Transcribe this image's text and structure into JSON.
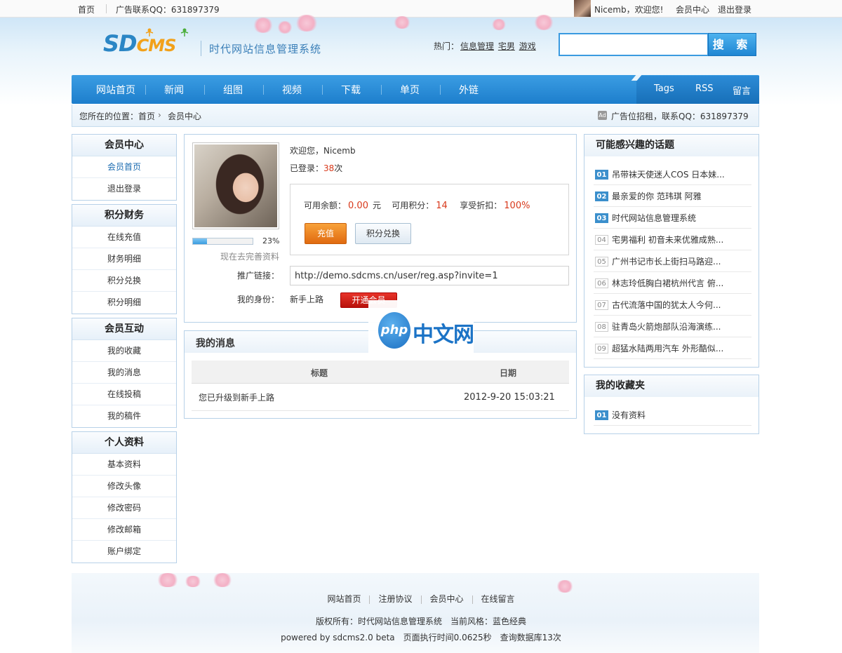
{
  "topbar": {
    "home": "首页",
    "ad_contact": "广告联系QQ：631897379",
    "welcome": "Nicemb，欢迎您!",
    "member_center": "会员中心",
    "logout": "退出登录"
  },
  "header": {
    "logo_sd": "SD",
    "logo_cms": "CMS",
    "slogan": "时代网站信息管理系统",
    "hot_label": "热门：",
    "hot_links": [
      "信息管理",
      "宅男",
      "游戏"
    ],
    "search_placeholder": "",
    "search_button": "搜 索"
  },
  "nav": {
    "items": [
      "网站首页",
      "新闻",
      "组图",
      "视频",
      "下载",
      "单页",
      "外链"
    ],
    "right": [
      "Tags",
      "RSS",
      "留言"
    ]
  },
  "breadcrumb": {
    "prefix": "您所在的位置：",
    "home": "首页",
    "current": "会员中心",
    "ad_icon": "Ad",
    "ad_text": "广告位招租，联系QQ：631897379"
  },
  "sidebar": [
    {
      "title": "会员中心",
      "items": [
        "会员首页",
        "退出登录"
      ]
    },
    {
      "title": "积分财务",
      "items": [
        "在线充值",
        "财务明细",
        "积分兑换",
        "积分明细"
      ]
    },
    {
      "title": "会员互动",
      "items": [
        "我的收藏",
        "我的消息",
        "在线投稿",
        "我的稿件"
      ]
    },
    {
      "title": "个人资料",
      "items": [
        "基本资料",
        "修改头像",
        "修改密码",
        "修改邮箱",
        "账户绑定"
      ]
    }
  ],
  "profile": {
    "completion": 0.23,
    "completion_text": "23%",
    "complete_link": "现在去完善资料",
    "welcome_prefix": "欢迎您，",
    "username": "Nicemb",
    "logins_prefix": "已登录：",
    "logins_count": "38",
    "logins_suffix": "次",
    "balance_label": "可用余额：",
    "balance": "0.00",
    "balance_unit": "元",
    "points_label": "可用积分：",
    "points": "14",
    "discount_label": "享受折扣：",
    "discount": "100%",
    "recharge_button": "充值",
    "exchange_button": "积分兑换",
    "promo_label": "推广链接：",
    "promo_url": "http://demo.sdcms.cn/user/reg.asp?invite=1",
    "identity_label": "我的身份：",
    "identity": "新手上路",
    "vip_button": "开通会员"
  },
  "messages": {
    "title": "我的消息",
    "columns": [
      "标题",
      "日期"
    ],
    "rows": [
      {
        "title": "您已升级到新手上路",
        "date": "2012-9-20 15:03:21"
      }
    ]
  },
  "watermark": {
    "logo": "php",
    "text": "中文网"
  },
  "topics": {
    "title": "可能感兴趣的话题",
    "items": [
      {
        "num": "01",
        "text": "吊带袜天使迷人COS 日本妹..."
      },
      {
        "num": "02",
        "text": "最亲爱的你 范玮琪 阿雅"
      },
      {
        "num": "03",
        "text": "时代网站信息管理系统"
      },
      {
        "num": "04",
        "text": "宅男福利 初音未来优雅成熟..."
      },
      {
        "num": "05",
        "text": "广州书记市长上街扫马路迎..."
      },
      {
        "num": "06",
        "text": "林志玲低胸白裙杭州代言 俯..."
      },
      {
        "num": "07",
        "text": "古代流落中国的犹太人今何..."
      },
      {
        "num": "08",
        "text": "驻青岛火箭炮部队沿海演练..."
      },
      {
        "num": "09",
        "text": "超猛水陆两用汽车 外形酷似..."
      }
    ]
  },
  "favorites": {
    "title": "我的收藏夹",
    "items": [
      {
        "num": "01",
        "text": "没有资料"
      }
    ]
  },
  "footer": {
    "links": [
      "网站首页",
      "注册协议",
      "会员中心",
      "在线留言"
    ],
    "copyright": "版权所有：时代网站信息管理系统　当前风格：蓝色经典",
    "powered": "powered by sdcms2.0 beta　页面执行时间0.0625秒　查询数据库13次"
  }
}
